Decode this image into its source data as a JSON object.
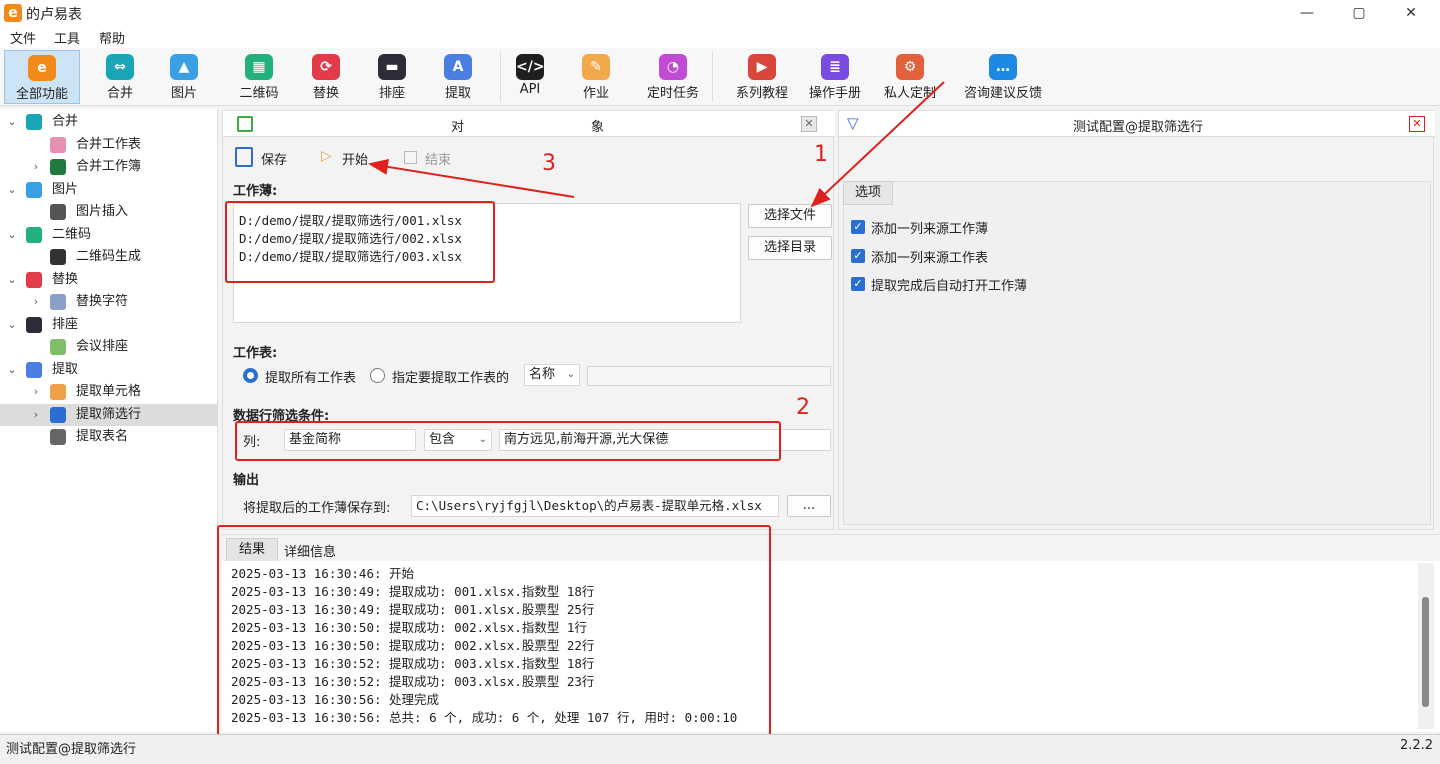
{
  "window": {
    "title": "的卢易表",
    "logo_letter": "e",
    "controls": [
      "—",
      "▢",
      "✕"
    ]
  },
  "menu": [
    "文件",
    "工具",
    "帮助"
  ],
  "toolbar": [
    {
      "name": "all",
      "label": "全部功能",
      "icon": "e",
      "color": "#f28a1a",
      "active": true
    },
    {
      "name": "merge",
      "label": "合并",
      "icon": "⇔",
      "color": "#1aa6b7"
    },
    {
      "name": "image",
      "label": "图片",
      "icon": "▲",
      "color": "#3aa0e6"
    },
    {
      "name": "qrcode",
      "label": "二维码",
      "icon": "▦",
      "color": "#22b07d"
    },
    {
      "name": "replace",
      "label": "替换",
      "icon": "⟳",
      "color": "#e23b4a"
    },
    {
      "name": "seating",
      "label": "排座",
      "icon": "▬",
      "color": "#2d2d3a"
    },
    {
      "name": "extract",
      "label": "提取",
      "icon": "A",
      "color": "#4a7ee0"
    },
    {
      "name": "api",
      "label": "API",
      "icon": "</>",
      "color": "#1e1e1e"
    },
    {
      "name": "homework",
      "label": "作业",
      "icon": "✎",
      "color": "#f2a94b"
    },
    {
      "name": "scheduled",
      "label": "定时任务",
      "icon": "◔",
      "color": "#c24bd6"
    },
    {
      "name": "tutorial",
      "label": "系列教程",
      "icon": "▶",
      "color": "#d9463a"
    },
    {
      "name": "manual",
      "label": "操作手册",
      "icon": "≣",
      "color": "#7a4be0"
    },
    {
      "name": "custom",
      "label": "私人定制",
      "icon": "⚙",
      "color": "#e2603a"
    },
    {
      "name": "feedback",
      "label": "咨询建议反馈",
      "icon": "…",
      "color": "#1e88e5"
    }
  ],
  "tree": [
    {
      "label": "合并",
      "level": 0,
      "arrow": "v",
      "color": "#1aa6b7"
    },
    {
      "label": "合并工作表",
      "level": 1,
      "arrow": "",
      "color": "#e88fb5"
    },
    {
      "label": "合并工作簿",
      "level": 1,
      "arrow": ">",
      "color": "#1f7a3f"
    },
    {
      "label": "图片",
      "level": 0,
      "arrow": "v",
      "color": "#3aa0e6"
    },
    {
      "label": "图片插入",
      "level": 1,
      "arrow": "",
      "color": "#555555"
    },
    {
      "label": "二维码",
      "level": 0,
      "arrow": "v",
      "color": "#22b07d"
    },
    {
      "label": "二维码生成",
      "level": 1,
      "arrow": "",
      "color": "#333333"
    },
    {
      "label": "替换",
      "level": 0,
      "arrow": "v",
      "color": "#e23b4a"
    },
    {
      "label": "替换字符",
      "level": 1,
      "arrow": ">",
      "color": "#8aa0c8"
    },
    {
      "label": "排座",
      "level": 0,
      "arrow": "v",
      "color": "#2d2d3a"
    },
    {
      "label": "会议排座",
      "level": 1,
      "arrow": "",
      "color": "#7fbf6a"
    },
    {
      "label": "提取",
      "level": 0,
      "arrow": "v",
      "color": "#4a7ee0"
    },
    {
      "label": "提取单元格",
      "level": 1,
      "arrow": ">",
      "color": "#f0a04b"
    },
    {
      "label": "提取筛选行",
      "level": 1,
      "arrow": ">",
      "color": "#2b6ed2",
      "selected": true
    },
    {
      "label": "提取表名",
      "level": 1,
      "arrow": "",
      "color": "#666666"
    }
  ],
  "center": {
    "header_left": "对",
    "header_right": "象",
    "save_label": "保存",
    "start_label": "开始",
    "end_label": "结束",
    "workbook_label": "工作薄:",
    "files": [
      "D:/demo/提取/提取筛选行/001.xlsx",
      "D:/demo/提取/提取筛选行/002.xlsx",
      "D:/demo/提取/提取筛选行/003.xlsx"
    ],
    "select_file": "选择文件",
    "select_dir": "选择目录",
    "sheet_label": "工作表:",
    "radio_all": "提取所有工作表",
    "radio_specific": "指定要提取工作表的",
    "name_select": "名称",
    "filter_label": "数据行筛选条件:",
    "col_label": "列:",
    "col_value": "基金简称",
    "op_value": "包含",
    "filter_value": "南方远见,前海开源,光大保德",
    "output_label": "输出",
    "save_to_label": "将提取后的工作薄保存到:",
    "save_path": "C:\\Users\\ryjfgjl\\Desktop\\的卢易表-提取单元格.xlsx",
    "browse": "..."
  },
  "right": {
    "title": "测试配置@提取筛选行",
    "tab": "选项",
    "options": [
      "添加一列来源工作薄",
      "添加一列来源工作表",
      "提取完成后自动打开工作薄"
    ]
  },
  "log": {
    "tabs": [
      "结果",
      "详细信息"
    ],
    "lines": [
      "2025-03-13 16:30:46: 开始",
      "2025-03-13 16:30:49: 提取成功: 001.xlsx.指数型 18行",
      "2025-03-13 16:30:49: 提取成功: 001.xlsx.股票型 25行",
      "2025-03-13 16:30:50: 提取成功: 002.xlsx.指数型 1行",
      "2025-03-13 16:30:50: 提取成功: 002.xlsx.股票型 22行",
      "2025-03-13 16:30:52: 提取成功: 003.xlsx.指数型 18行",
      "2025-03-13 16:30:52: 提取成功: 003.xlsx.股票型 23行",
      "2025-03-13 16:30:56: 处理完成",
      "2025-03-13 16:30:56: 总共: 6 个, 成功: 6 个, 处理 107 行, 用时: 0:00:10"
    ]
  },
  "status": {
    "left": "测试配置@提取筛选行",
    "version": "2.2.2"
  },
  "annotations": {
    "n1": "1",
    "n2": "2",
    "n3": "3"
  },
  "colors": {
    "accent": "#2b6ed2",
    "annotation": "#e0201d",
    "selected_tool": "#cde4f7"
  }
}
